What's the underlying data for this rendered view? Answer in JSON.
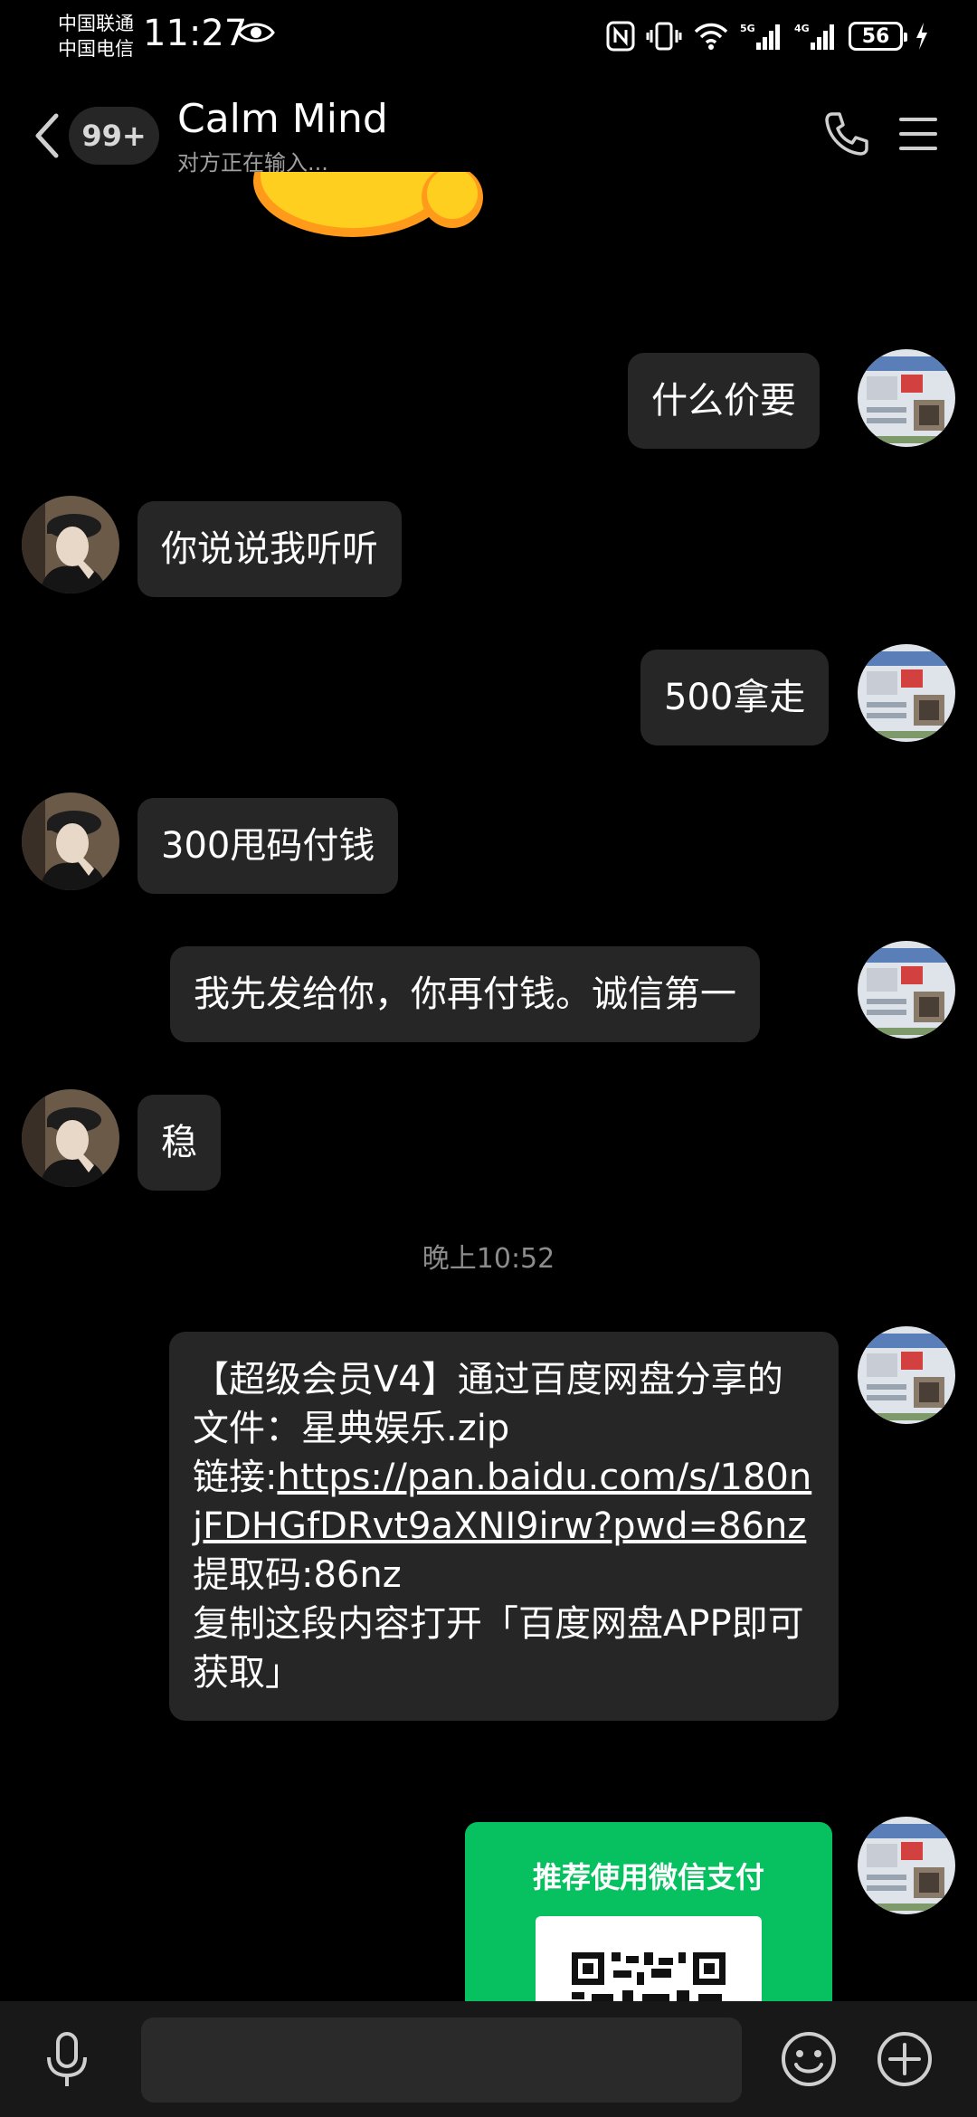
{
  "status_bar": {
    "carrier_1": "中国联通",
    "carrier_2": "中国电信",
    "time": "11:27",
    "network_1": "5G",
    "network_2": "4G",
    "battery": "56"
  },
  "header": {
    "back_label": "<",
    "unread_badge": "99+",
    "contact_name": "Calm Mind",
    "typing_status": "对方正在输入..."
  },
  "messages": [
    {
      "direction": "out",
      "text": "什么价要"
    },
    {
      "direction": "in",
      "text": "你说说我听听"
    },
    {
      "direction": "out",
      "text": "500拿走"
    },
    {
      "direction": "in",
      "text": "300甩码付钱"
    },
    {
      "direction": "out",
      "text": "我先发给你，你再付钱。诚信第一"
    },
    {
      "direction": "in",
      "text": "稳"
    }
  ],
  "time_label": "晚上10:52",
  "file_message": {
    "line_1": "【超级会员V4】通过百度网盘分享的文件：星典娱乐.zip",
    "link_prefix": "链接:",
    "link": "https://pan.baidu.com/s/180njFDHGfDRvt9aXNI9irw?pwd=86nz",
    "code": "提取码:86nz",
    "note": "复制这段内容打开「百度网盘APP即可获取」"
  },
  "payment_card": {
    "title": "推荐使用微信支付"
  },
  "input": {
    "placeholder": ""
  },
  "colors": {
    "background": "#000000",
    "bubble": "#262626",
    "pay_green": "#07c160",
    "input_bar": "#181818"
  }
}
